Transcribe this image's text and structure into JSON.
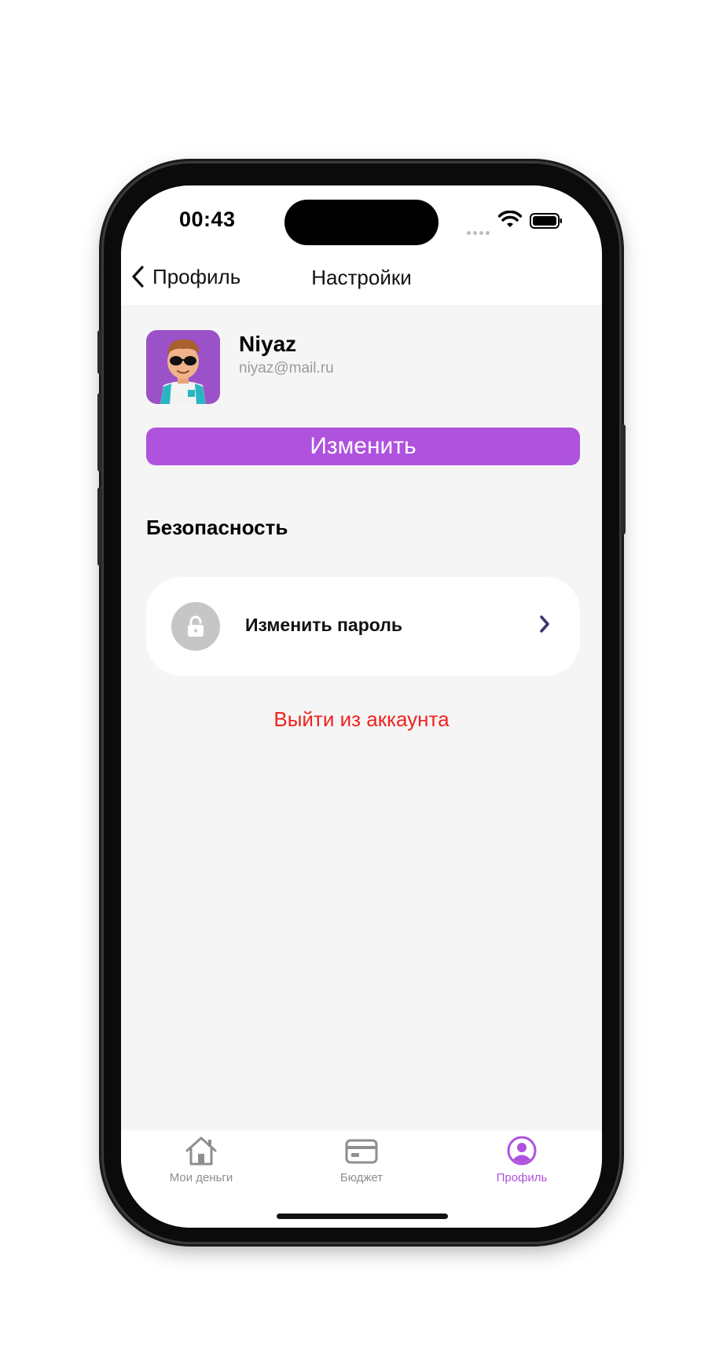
{
  "status_bar": {
    "time": "00:43"
  },
  "nav": {
    "back_label": "Профиль",
    "title": "Настройки"
  },
  "profile": {
    "name": "Niyaz",
    "email": "niyaz@mail.ru",
    "edit_label": "Изменить"
  },
  "security": {
    "section_title": "Безопасность",
    "change_password_label": "Изменить пароль"
  },
  "logout_label": "Выйти из аккаунта",
  "tabs": [
    {
      "label": "Мои деньги",
      "icon": "house-icon",
      "active": false
    },
    {
      "label": "Бюджет",
      "icon": "credit-card-icon",
      "active": false
    },
    {
      "label": "Профиль",
      "icon": "person-circle-icon",
      "active": true
    }
  ],
  "colors": {
    "accent": "#af52de",
    "logout": "#f1221e",
    "background": "#f5f5f5",
    "inactive_tab": "#8e8e93"
  }
}
